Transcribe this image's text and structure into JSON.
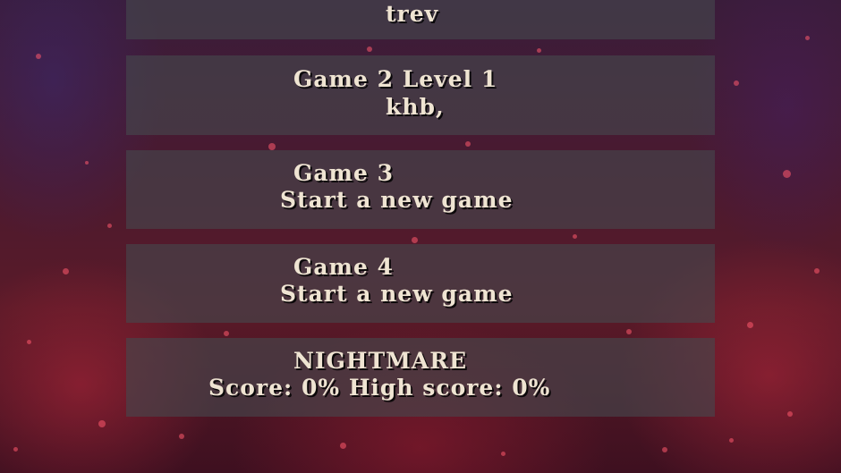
{
  "save_slots": [
    {
      "title": "",
      "subtitle": "trev"
    },
    {
      "title": "Game 2  Level 1",
      "subtitle": "khb,"
    },
    {
      "title": "Game 3",
      "subtitle": "Start a new game"
    },
    {
      "title": "Game 4",
      "subtitle": "Start a new game"
    }
  ],
  "nightmare": {
    "title": "NIGHTMARE",
    "score_line": "Score: 0%  High score: 0%"
  }
}
